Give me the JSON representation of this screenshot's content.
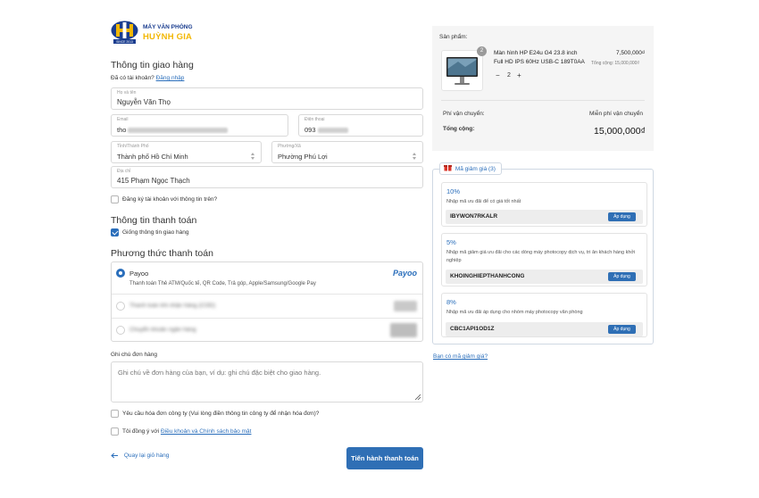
{
  "brand": {
    "line1": "MÁY VĂN PHÒNG",
    "line2": "HUỲNH GIA",
    "since": "SINCE 2013"
  },
  "shipping": {
    "heading": "Thông tin giao hàng",
    "have_account": "Đã có tài khoản?",
    "login_link": "Đăng nhập",
    "name_label": "Họ và tên",
    "name_value": "Nguyễn Văn Thọ",
    "email_label": "Email",
    "email_value": "tho",
    "phone_label": "Điện thoại",
    "phone_value": "093",
    "city_label": "Tỉnh/Thành Phố",
    "city_value": "Thành phố Hồ Chí Minh",
    "ward_label": "Phường/Xã",
    "ward_value": "Phường Phú Lợi",
    "address_label": "Địa chỉ",
    "address_value": "415 Phạm Ngọc Thạch",
    "register_label": "Đăng ký tài khoản với thông tin trên?"
  },
  "payment_info": {
    "heading": "Thông tin thanh toán",
    "same_label": "Giống thông tin giao hàng"
  },
  "payment_method": {
    "heading": "Phương thức thanh toán",
    "payoo_name": "Payoo",
    "payoo_desc": "Thanh toán Thẻ ATM/Quốc tế, QR Code, Trả góp, Apple/Samsung/Google Pay",
    "payoo_logo": "Payoo",
    "option2": "Thanh toán khi nhận hàng (COD)",
    "option3": "Chuyển khoản ngân hàng"
  },
  "order_note": {
    "label": "Ghi chú đơn hàng",
    "placeholder": "Ghi chú về đơn hàng của bạn, ví dụ: ghi chú đặc biệt cho giao hàng."
  },
  "invoice_label": "Yêu cầu hóa đơn công ty (Vui lòng điền thông tin công ty để nhận hóa đơn)?",
  "terms": {
    "prefix": "Tôi đồng ý với",
    "link": "Điều khoản và Chính sách bảo mật"
  },
  "back_link": "Quay lại giỏ hàng",
  "checkout_button": "Tiến hành thanh toán",
  "summary": {
    "products_label": "Sản phẩm:",
    "badge": "2",
    "product_name_line1": "Màn hình HP E24u G4 23.8 inch",
    "product_name_line2": "Full HD IPS 60Hz USB-C 189T0AA",
    "unit_price": "7,500,000₫",
    "line_total": "Tổng cộng: 15,000,000₫",
    "qty": "2",
    "minus": "−",
    "plus": "+",
    "shipping_label": "Phí vận chuyển:",
    "shipping_value": "Miễn phí vận chuyển",
    "total_label": "Tổng cộng:",
    "total_value": "15,000,000₫"
  },
  "coupons": {
    "tab_label": "Mã giảm giá (3)",
    "items": [
      {
        "pct": "10%",
        "desc": "Nhập mã ưu đãi để có giá tốt nhất",
        "code": "IBYWON7RKALR",
        "apply": "Áp dụng"
      },
      {
        "pct": "5%",
        "desc": "Nhập mã giảm giá ưu đãi cho các dòng máy photocopy dịch vụ, tri ân khách hàng khởi nghiệp",
        "code": "KHOINGHIEPTHANHCONG",
        "apply": "Áp dụng"
      },
      {
        "pct": "8%",
        "desc": "Nhập mã ưu đãi áp dụng cho nhóm máy photocopy văn phòng",
        "code": "CBC1API1OD1Z",
        "apply": "Áp dụng"
      }
    ],
    "have_code_link": "Bạn có mã giảm giá?"
  },
  "colors": {
    "accent": "#2f6fb5",
    "brand_blue": "#1a3d8f",
    "brand_yellow": "#f2b705"
  }
}
